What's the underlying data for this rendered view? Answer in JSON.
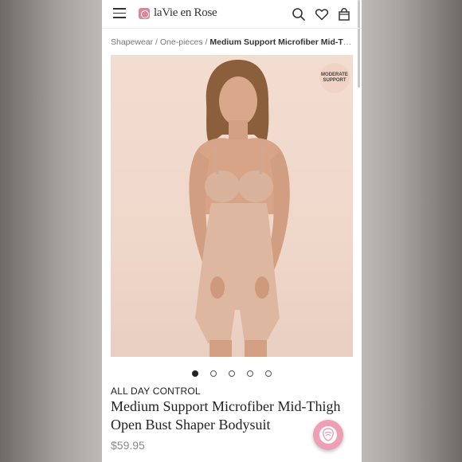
{
  "brand": {
    "logo_text": "laVie en Rose"
  },
  "header": {
    "icons": [
      "menu-icon",
      "search-icon",
      "heart-icon",
      "bag-icon"
    ]
  },
  "breadcrumb": {
    "items": [
      "Shapewear",
      "One-pieces"
    ],
    "separator": " / ",
    "current": "Medium Support Microfiber Mid-Thigh O..."
  },
  "product_image": {
    "badge_line1": "MODERATE",
    "badge_line2": "SUPPORT",
    "carousel": {
      "total": 5,
      "active_index": 0
    }
  },
  "product": {
    "collection": "ALL DAY CONTROL",
    "title": "Medium Support Microfiber Mid-Thigh Open Bust Shaper Bodysuit",
    "price": "$59.95"
  },
  "colors": {
    "accent": "#ee9fb5",
    "logo": "#d9879a",
    "photo_bg": "#f0d9cc"
  }
}
